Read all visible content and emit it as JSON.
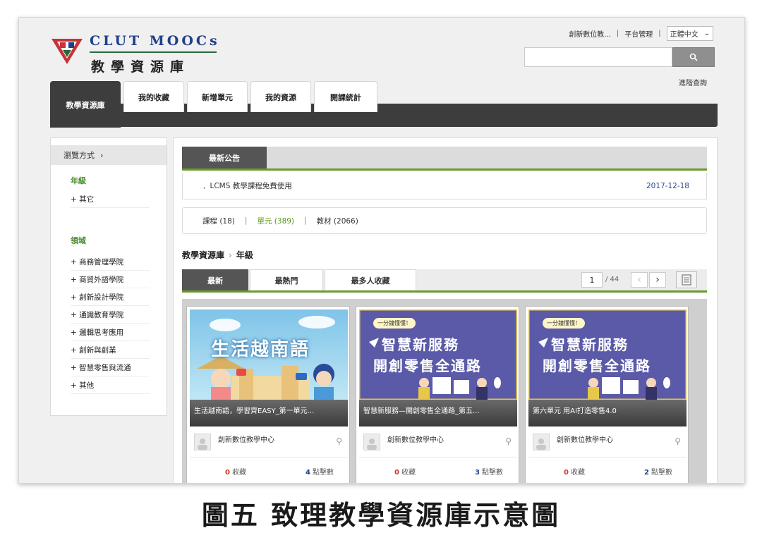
{
  "header": {
    "logo_title": "CLUT MOOCs",
    "logo_subtitle": "教學資源庫",
    "top_links": [
      "創新數位教...",
      "平台管理"
    ],
    "language": "正體中文",
    "advanced_search": "進階查詢"
  },
  "nav": {
    "tabs": [
      "教學資源庫",
      "我的收藏",
      "新增單元",
      "我的資源",
      "開課統計"
    ]
  },
  "sidebar": {
    "browse_label": "瀏覽方式",
    "groups": [
      {
        "title": "年級",
        "items": [
          "+ 其它"
        ]
      },
      {
        "title": "領域",
        "items": [
          "+ 商務管理學院",
          "+ 商貿外語學院",
          "+ 創新設計學院",
          "+ 通識教育學院",
          "+ 邏輯思考應用",
          "+ 創新與創業",
          "+ 智慧零售與流通",
          "+ 其他"
        ]
      }
    ]
  },
  "notice": {
    "tab_label": "最新公告",
    "text": "．LCMS 教學課程免費使用",
    "date": "2017-12-18"
  },
  "counts": {
    "courses": "課程 (18)",
    "units": "單元 (389)",
    "materials": "教材 (2066)"
  },
  "breadcrumb": {
    "root": "教學資源庫",
    "current": "年級"
  },
  "sort": {
    "tabs": [
      "最新",
      "最熱門",
      "最多人收藏"
    ],
    "page": "1",
    "total": "/ 44"
  },
  "cards": [
    {
      "thumb_title": "生活越南語",
      "caption": "生活越南語，學習齊EASY_第一單元...",
      "author": "創新數位教學中心",
      "favorites_num": "0",
      "favorites_label": "收藏",
      "views_num": "4",
      "views_label": "點擊數"
    },
    {
      "thumb_tag": "一分鐘懂懂！",
      "thumb_line1": "智慧新服務",
      "thumb_line2": "開創零售全通路",
      "caption": "智慧新服務—開創零售全通路_第五...",
      "author": "創新數位教學中心",
      "favorites_num": "0",
      "favorites_label": "收藏",
      "views_num": "3",
      "views_label": "點擊數"
    },
    {
      "thumb_tag": "一分鐘懂懂！",
      "thumb_line1": "智慧新服務",
      "thumb_line2": "開創零售全通路",
      "caption": "第六單元 用AI打造零售4.0",
      "author": "創新數位教學中心",
      "favorites_num": "0",
      "favorites_label": "收藏",
      "views_num": "2",
      "views_label": "點擊數"
    }
  ],
  "figure_caption": "圖五 致理教學資源庫示意圖",
  "colors": {
    "nav_dark": "#3d3d3d",
    "accent_green": "#6a9a2a",
    "brand_blue": "#1f3f8a"
  }
}
